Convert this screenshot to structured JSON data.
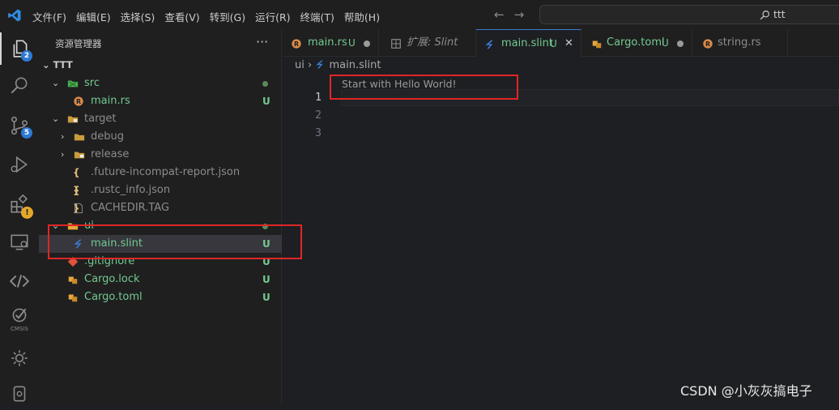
{
  "menu": [
    "文件(F)",
    "编辑(E)",
    "选择(S)",
    "查看(V)",
    "转到(G)",
    "运行(R)",
    "终端(T)",
    "帮助(H)"
  ],
  "nav": {
    "back": "←",
    "forward": "→"
  },
  "search": {
    "text": "ttt"
  },
  "activity": {
    "explorer_badge": "2",
    "scm_badge": "5",
    "cmsis_label": "CMSIS",
    "warn": "!"
  },
  "sidebar": {
    "title": "资源管理器",
    "more": "···",
    "root": "TTT",
    "rows": [
      {
        "label": "src",
        "status": ""
      },
      {
        "label": "main.rs",
        "status": "U"
      },
      {
        "label": "target",
        "status": ""
      },
      {
        "label": "debug",
        "status": ""
      },
      {
        "label": "release",
        "status": ""
      },
      {
        "label": ".future-incompat-report.json",
        "status": ""
      },
      {
        "label": ".rustc_info.json",
        "status": ""
      },
      {
        "label": "CACHEDIR.TAG",
        "status": ""
      },
      {
        "label": "ui",
        "status": ""
      },
      {
        "label": "main.slint",
        "status": "U"
      },
      {
        "label": ".gitignore",
        "status": "U"
      },
      {
        "label": "Cargo.lock",
        "status": "U"
      },
      {
        "label": "Cargo.toml",
        "status": "U"
      }
    ]
  },
  "tabs": [
    {
      "label": "main.rs",
      "status": "U"
    },
    {
      "label": "扩展: Slint",
      "status": ""
    },
    {
      "label": "main.slint",
      "status": "U"
    },
    {
      "label": "Cargo.toml",
      "status": "U"
    },
    {
      "label": "string.rs",
      "status": ""
    }
  ],
  "breadcrumb": {
    "folder": "ui",
    "sep": "›",
    "file": "main.slint"
  },
  "editor": {
    "hint": "Start with Hello World!",
    "line_numbers": [
      "1",
      "2",
      "3"
    ],
    "current_line": 1
  },
  "watermark": "CSDN @小灰灰搞电子",
  "colors": {
    "accent": "#3a7bd5",
    "untracked": "#73c991",
    "annotation": "#e02626",
    "slint": "#3a7bd5",
    "rust": "#d98a4a",
    "toml": "#e5a83a"
  }
}
